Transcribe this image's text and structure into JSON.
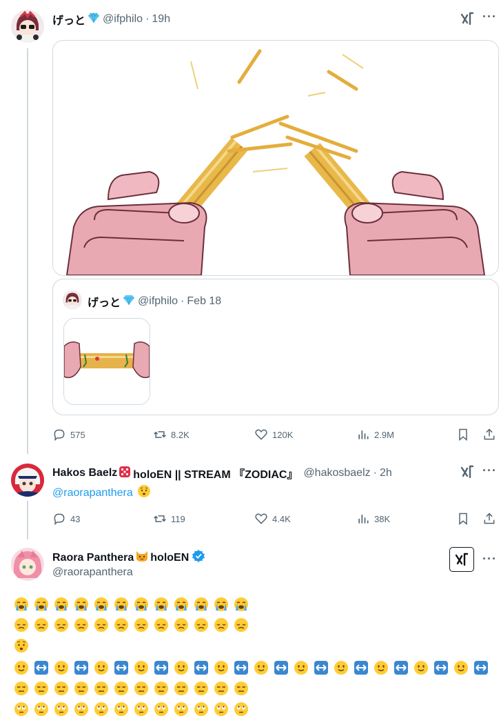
{
  "post1": {
    "display_name": "げっと",
    "badge_icon": "gem-icon",
    "handle": "@ifphilo",
    "separator": "·",
    "time": "19h",
    "quote": {
      "display_name": "げっと",
      "handle": "@ifphilo",
      "date": "Feb 18"
    },
    "stats": {
      "replies": "575",
      "reposts": "8.2K",
      "likes": "120K",
      "views": "2.9M"
    }
  },
  "post2": {
    "display_name": "Hakos Baelz",
    "badge_icon": "dice-icon",
    "name_suffix": "holoEN || STREAM 『ZODIAC』",
    "handle": "@hakosbaelz",
    "separator": "·",
    "time": "2h",
    "mention": "@raorapanthera",
    "reaction_emoji": "worried-face-icon",
    "stats": {
      "replies": "43",
      "reposts": "119",
      "likes": "4.4K",
      "views": "38K"
    }
  },
  "post3": {
    "display_name": "Raora Panthera",
    "badge_icon": "cat-face-icon",
    "name_suffix": "holoEN",
    "verified": true,
    "handle": "@raorapanthera",
    "emoji_lines": [
      {
        "emoji": "loudly-crying-face",
        "count": 12
      },
      {
        "emoji": "disappointed-face",
        "count": 12
      },
      {
        "emoji": "worried-face",
        "count": 1
      },
      {
        "emoji": "slightly-smiling-face + left-right-arrow",
        "count": 12
      },
      {
        "emoji": "expressionless-face",
        "count": 12
      },
      {
        "emoji": "face-with-rolling-eyes",
        "count": 12
      }
    ]
  },
  "colors": {
    "link": "#1d9bf0",
    "muted": "#536471",
    "thread_line": "#cfd9de",
    "verified": "#1d9bf0"
  }
}
